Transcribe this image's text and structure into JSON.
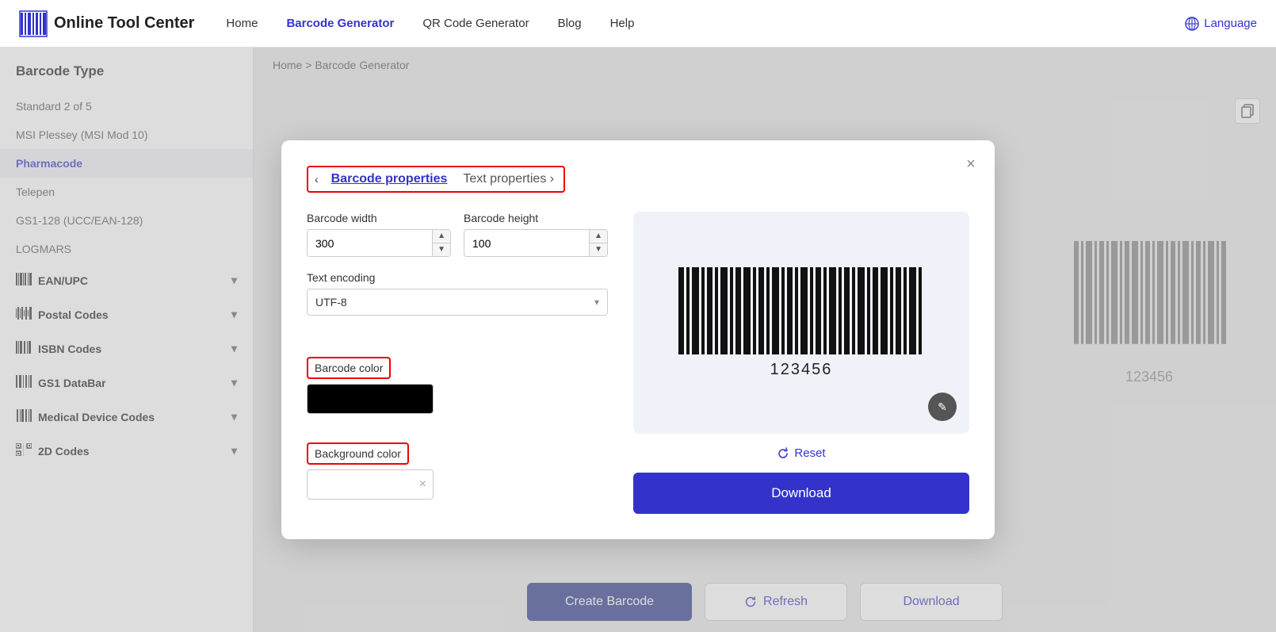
{
  "navbar": {
    "logo_text": "Online Tool Center",
    "nav_items": [
      {
        "label": "Home",
        "active": false
      },
      {
        "label": "Barcode Generator",
        "active": true
      },
      {
        "label": "QR Code Generator",
        "active": false
      },
      {
        "label": "Blog",
        "active": false
      },
      {
        "label": "Help",
        "active": false
      }
    ],
    "language_label": "Language"
  },
  "sidebar": {
    "title": "Barcode Type",
    "items": [
      {
        "label": "Standard 2 of 5",
        "active": false
      },
      {
        "label": "MSI Plessey (MSI Mod 10)",
        "active": false
      },
      {
        "label": "Pharmacode",
        "active": true
      },
      {
        "label": "Telepen",
        "active": false
      },
      {
        "label": "GS1-128 (UCC/EAN-128)",
        "active": false
      },
      {
        "label": "LOGMARS",
        "active": false
      }
    ],
    "groups": [
      {
        "label": "EAN/UPC"
      },
      {
        "label": "Postal Codes"
      },
      {
        "label": "ISBN Codes"
      },
      {
        "label": "GS1 DataBar"
      },
      {
        "label": "Medical Device Codes"
      },
      {
        "label": "2D Codes"
      }
    ]
  },
  "breadcrumb": {
    "home": "Home",
    "separator": ">",
    "current": "Barcode Generator"
  },
  "bg_barcode": {
    "number": "123456"
  },
  "bottom_buttons": {
    "create_label": "Create Barcode",
    "refresh_label": "Refresh",
    "download_label": "Download"
  },
  "modal": {
    "tab_barcode": "Barcode properties",
    "tab_text": "Text properties",
    "close_label": "×",
    "barcode_width_label": "Barcode width",
    "barcode_width_value": "300",
    "barcode_height_label": "Barcode height",
    "barcode_height_value": "100",
    "text_encoding_label": "Text encoding",
    "text_encoding_value": "UTF-8",
    "barcode_color_label": "Barcode color",
    "background_color_label": "Background color",
    "bg_color_clear": "×",
    "reset_label": "Reset",
    "download_label": "Download",
    "barcode_number": "123456",
    "edit_icon": "✎"
  }
}
